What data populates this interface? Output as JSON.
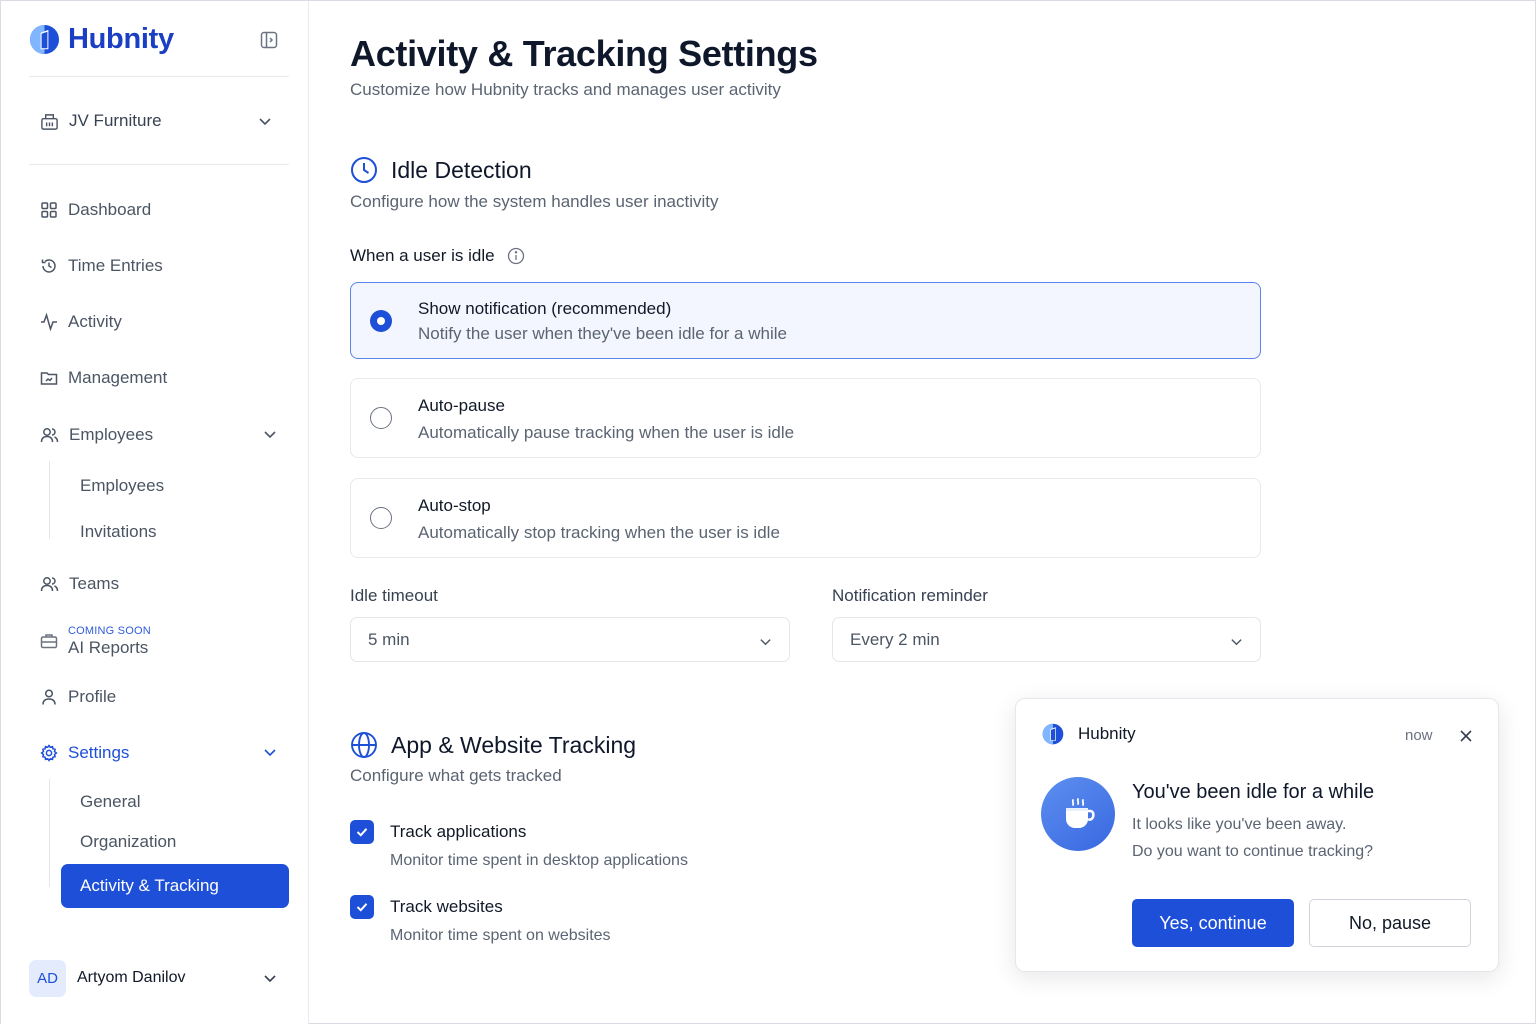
{
  "sidebar": {
    "brand": "Hubnity",
    "workspace": "JV Furniture",
    "items": {
      "dashboard": "Dashboard",
      "time_entries": "Time Entries",
      "activity": "Activity",
      "management": "Management",
      "employees": "Employees",
      "employees_sub": "Employees",
      "invitations": "Invitations",
      "teams": "Teams",
      "ai_badge": "COMING SOON",
      "ai_reports": "AI Reports",
      "profile": "Profile",
      "settings": "Settings",
      "general": "General",
      "organization": "Organization",
      "activity_tracking": "Activity & Tracking"
    },
    "user": {
      "initials": "AD",
      "name": "Artyom Danilov"
    }
  },
  "main": {
    "title": "Activity & Tracking Settings",
    "subtitle": "Customize how Hubnity tracks and manages user activity",
    "idle": {
      "title": "Idle Detection",
      "subtitle": "Configure how the system handles user inactivity",
      "field_label": "When a user is idle",
      "options": [
        {
          "title": "Show notification (recommended)",
          "desc": "Notify the user when they've been idle for a while",
          "selected": true
        },
        {
          "title": "Auto-pause",
          "desc": "Automatically pause tracking when the user is idle",
          "selected": false
        },
        {
          "title": "Auto-stop",
          "desc": "Automatically stop tracking when the user is idle",
          "selected": false
        }
      ],
      "timeout_label": "Idle timeout",
      "timeout_value": "5 min",
      "reminder_label": "Notification reminder",
      "reminder_value": "Every 2 min"
    },
    "tracking": {
      "title": "App & Website Tracking",
      "subtitle": "Configure what gets tracked",
      "items": [
        {
          "title": "Track applications",
          "desc": "Monitor time spent in desktop applications",
          "checked": true
        },
        {
          "title": "Track websites",
          "desc": "Monitor time spent on websites",
          "checked": true
        }
      ]
    }
  },
  "toast": {
    "app": "Hubnity",
    "time": "now",
    "title": "You've been idle for a while",
    "line1": "It looks like you've been away.",
    "line2": "Do you want to continue tracking?",
    "primary": "Yes, continue",
    "secondary": "No, pause"
  },
  "colors": {
    "accent": "#1d4fd8",
    "brand": "#1a3fc4"
  }
}
